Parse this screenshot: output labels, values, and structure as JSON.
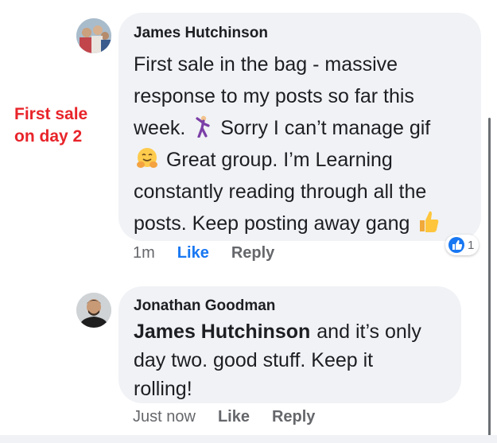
{
  "annotation": {
    "line1": "First sale",
    "line2": "on day 2",
    "color": "#e8242a"
  },
  "comments": [
    {
      "author": "James Hutchinson",
      "lines": [
        "First sale in the bag - massive",
        "response to my posts so far this",
        "week.",
        "Sorry I can’t manage gif",
        "Great group. I’m Learning",
        "constantly reading through all the",
        "posts. Keep posting away gang"
      ],
      "emojis": [
        "dancing-man-icon",
        "hugging-face-icon",
        "thumbs-up-icon"
      ],
      "time": "1m",
      "like_label": "Like",
      "reply_label": "Reply",
      "reaction": {
        "icon": "like-reaction-icon",
        "count": "1"
      }
    },
    {
      "author": "Jonathan Goodman",
      "mention": "James Hutchinson",
      "lines": [
        "and it’s only",
        "day two. good stuff. Keep it",
        "rolling!"
      ],
      "time": "Just now",
      "like_label": "Like",
      "reply_label": "Reply"
    }
  ],
  "colors": {
    "bubble": "#f0f2f5",
    "link_blue": "#1877f2",
    "meta_grey": "#65676b"
  }
}
